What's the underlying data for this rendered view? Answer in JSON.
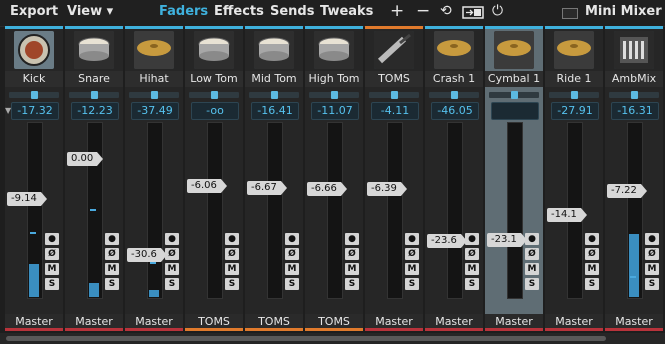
{
  "menu": {
    "export": "Export",
    "view": "View ▾"
  },
  "tabs": [
    "Faders",
    "Effects",
    "Sends",
    "Tweaks"
  ],
  "toolbar_icons": [
    "plus-icon",
    "minus-icon",
    "refresh-icon",
    "swap-icon",
    "power-icon"
  ],
  "mini_mixer_label": "Mini Mixer",
  "colors": {
    "accent_blue": "#3fb1dd",
    "toms_orange": "#e07a2c",
    "master_red": "#b8333b",
    "meter": "#3a8ec0"
  },
  "buttons": {
    "phase": "Ø",
    "mute": "M",
    "solo": "S"
  },
  "channels": [
    {
      "name": "Kick",
      "icon": "kick-drum-icon",
      "volume": "-17.32",
      "fader_label": "-9.14",
      "output": "Master",
      "accent": "blue",
      "out_color": "red",
      "meter_level": 0.19,
      "selected": false
    },
    {
      "name": "Snare",
      "icon": "snare-drum-icon",
      "volume": "-12.23",
      "fader_label": "0.00",
      "output": "Master",
      "accent": "blue",
      "out_color": "red",
      "meter_level": 0.08,
      "selected": false
    },
    {
      "name": "Hihat",
      "icon": "hihat-icon",
      "volume": "-37.49",
      "fader_label": "-30.6",
      "output": "Master",
      "accent": "blue",
      "out_color": "red",
      "meter_level": 0.04,
      "selected": false
    },
    {
      "name": "Low Tom",
      "icon": "low-tom-icon",
      "volume": "-oo",
      "fader_label": "-6.06",
      "output": "TOMS",
      "accent": "blue",
      "out_color": "orange",
      "meter_level": 0.0,
      "selected": false
    },
    {
      "name": "Mid Tom",
      "icon": "mid-tom-icon",
      "volume": "-16.41",
      "fader_label": "-6.67",
      "output": "TOMS",
      "accent": "blue",
      "out_color": "orange",
      "meter_level": 0.0,
      "selected": false
    },
    {
      "name": "High Tom",
      "icon": "high-tom-icon",
      "volume": "-11.07",
      "fader_label": "-6.66",
      "output": "TOMS",
      "accent": "blue",
      "out_color": "orange",
      "meter_level": 0.0,
      "selected": false
    },
    {
      "name": "TOMS",
      "icon": "mic-cable-icon",
      "volume": "-4.11",
      "fader_label": "-6.39",
      "output": "Master",
      "accent": "orange",
      "out_color": "red",
      "meter_level": 0.0,
      "selected": false
    },
    {
      "name": "Crash 1",
      "icon": "crash-cymbal-icon",
      "volume": "-46.05",
      "fader_label": "-23.6",
      "output": "Master",
      "accent": "blue",
      "out_color": "red",
      "meter_level": 0.0,
      "selected": false
    },
    {
      "name": "Cymbal 1",
      "icon": "cymbal-icon",
      "volume": "",
      "fader_label": "-23.1",
      "output": "Master",
      "accent": "blue",
      "out_color": "red",
      "meter_level": 0.0,
      "selected": true
    },
    {
      "name": "Ride 1",
      "icon": "ride-cymbal-icon",
      "volume": "-27.91",
      "fader_label": "-14.1",
      "output": "Master",
      "accent": "blue",
      "out_color": "red",
      "meter_level": 0.0,
      "selected": false
    },
    {
      "name": "AmbMix",
      "icon": "mixer-icon",
      "volume": "-16.31",
      "fader_label": "-7.22",
      "output": "Master",
      "accent": "blue",
      "out_color": "red",
      "meter_level": 0.36,
      "selected": false
    }
  ]
}
